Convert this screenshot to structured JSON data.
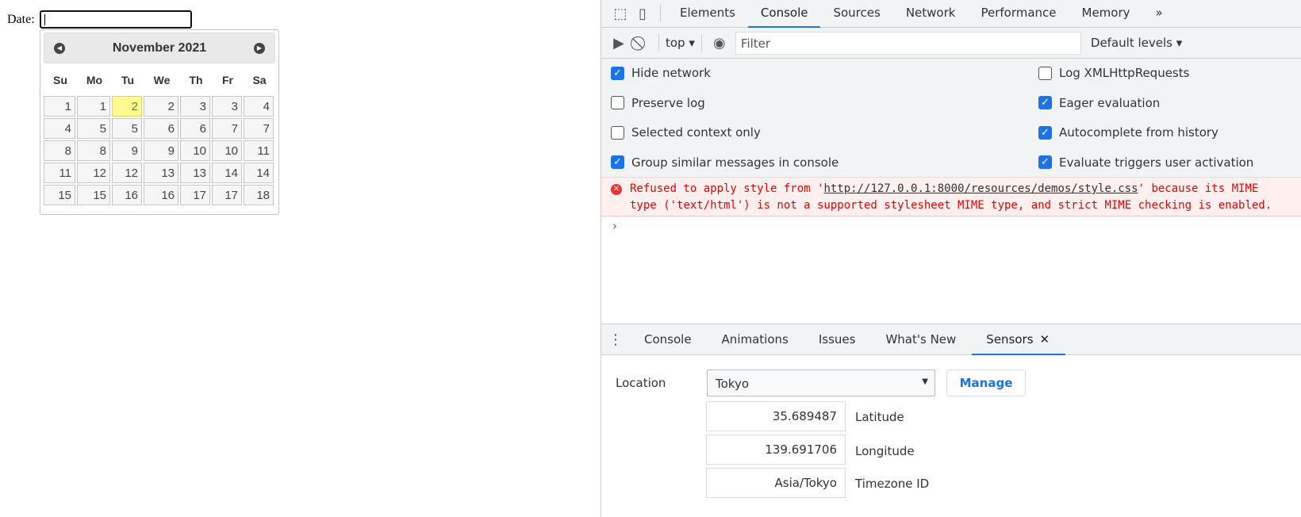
{
  "page": {
    "date_label": "Date:",
    "date_value": "",
    "calendar": {
      "title": "November 2021",
      "prev": "Prev",
      "next": "Next",
      "weekdays": [
        "Su",
        "Mo",
        "Tu",
        "We",
        "Th",
        "Fr",
        "Sa"
      ],
      "rows": [
        [
          "1",
          "1",
          "2",
          "2",
          "3",
          "3",
          "4"
        ],
        [
          "4",
          "5",
          "5",
          "6",
          "6",
          "7",
          "7"
        ],
        [
          "8",
          "8",
          "9",
          "9",
          "10",
          "10",
          "11"
        ],
        [
          "11",
          "12",
          "12",
          "13",
          "13",
          "14",
          "14"
        ],
        [
          "15",
          "15",
          "16",
          "16",
          "17",
          "17",
          "18"
        ]
      ],
      "highlighted": "2"
    }
  },
  "devtools": {
    "tabs": [
      "Elements",
      "Console",
      "Sources",
      "Network",
      "Performance",
      "Memory"
    ],
    "active_tab": "Console",
    "more": "»",
    "toolbar": {
      "context": "top",
      "filter_placeholder": "Filter",
      "levels": "Default levels"
    },
    "settings_left": [
      {
        "label": "Hide network",
        "checked": true
      },
      {
        "label": "Preserve log",
        "checked": false
      },
      {
        "label": "Selected context only",
        "checked": false
      },
      {
        "label": "Group similar messages in console",
        "checked": true
      }
    ],
    "settings_right": [
      {
        "label": "Log XMLHttpRequests",
        "checked": false
      },
      {
        "label": "Eager evaluation",
        "checked": true
      },
      {
        "label": "Autocomplete from history",
        "checked": true
      },
      {
        "label": "Evaluate triggers user activation",
        "checked": true
      }
    ],
    "error": {
      "prefix": "Refused to apply style from '",
      "url": "http://127.0.0.1:8000/resources/demos/style.css",
      "suffix": "' because its MIME",
      "line2": "type ('text/html') is not a supported stylesheet MIME type, and strict MIME checking is enabled."
    },
    "prompt": "›",
    "drawer_tabs": [
      "Console",
      "Animations",
      "Issues",
      "What's New",
      "Sensors"
    ],
    "drawer_active": "Sensors",
    "close": "✕",
    "sensors": {
      "location_label": "Location",
      "location": "Tokyo",
      "manage": "Manage",
      "latitude": "35.689487",
      "latitude_label": "Latitude",
      "longitude": "139.691706",
      "longitude_label": "Longitude",
      "timezone": "Asia/Tokyo",
      "timezone_label": "Timezone ID"
    },
    "accent": "#1a73e8",
    "error_color": "#e00000"
  }
}
